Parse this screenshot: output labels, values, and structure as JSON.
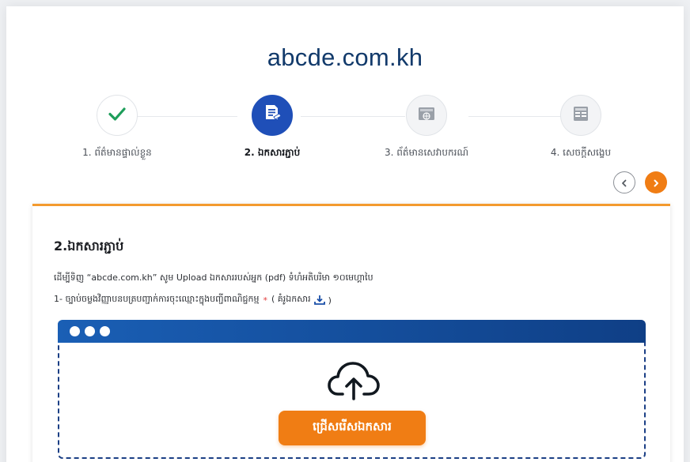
{
  "site": {
    "title": "abcde.com.kh"
  },
  "steps": [
    {
      "label": "1. ព័ត៌មានផ្ទាល់ខ្លួន",
      "state": "done",
      "icon": "check-icon"
    },
    {
      "label": "2. ឯកសារភ្ជាប់",
      "state": "active",
      "icon": "document-icon"
    },
    {
      "label": "3. ព័ត៌មានសេវាបករណ៍",
      "state": "pending",
      "icon": "server-icon"
    },
    {
      "label": "4. សេចក្ដីសង្ខេប",
      "state": "pending",
      "icon": "summary-icon"
    }
  ],
  "panel": {
    "title": "2.ឯកសារភ្ជាប់",
    "description": "ដើម្បីទិញ “abcde.com.kh” សូម Upload ឯកសាររបស់អ្នក (pdf) ទំហំអតិបរិមា ១០មេហ្គាបៃ",
    "requirement_text": "1- ច្បាប់ចម្លងវិញ្ញាបនបត្របញ្ជាក់ការចុះឈ្មោះក្នុងបញ្ជីពាណិជ្ជកម្ម",
    "required_mark": "*",
    "sample_open": "( គំរូឯកសារ",
    "sample_close": ")"
  },
  "upload": {
    "button_label": "ជ្រើសរើសឯកសារ"
  },
  "colors": {
    "accent": "#f07d14",
    "title": "#123a6b",
    "active_step": "#1f4fb8",
    "check": "#1e9e5a",
    "upload_bar": "#0f3f86"
  }
}
